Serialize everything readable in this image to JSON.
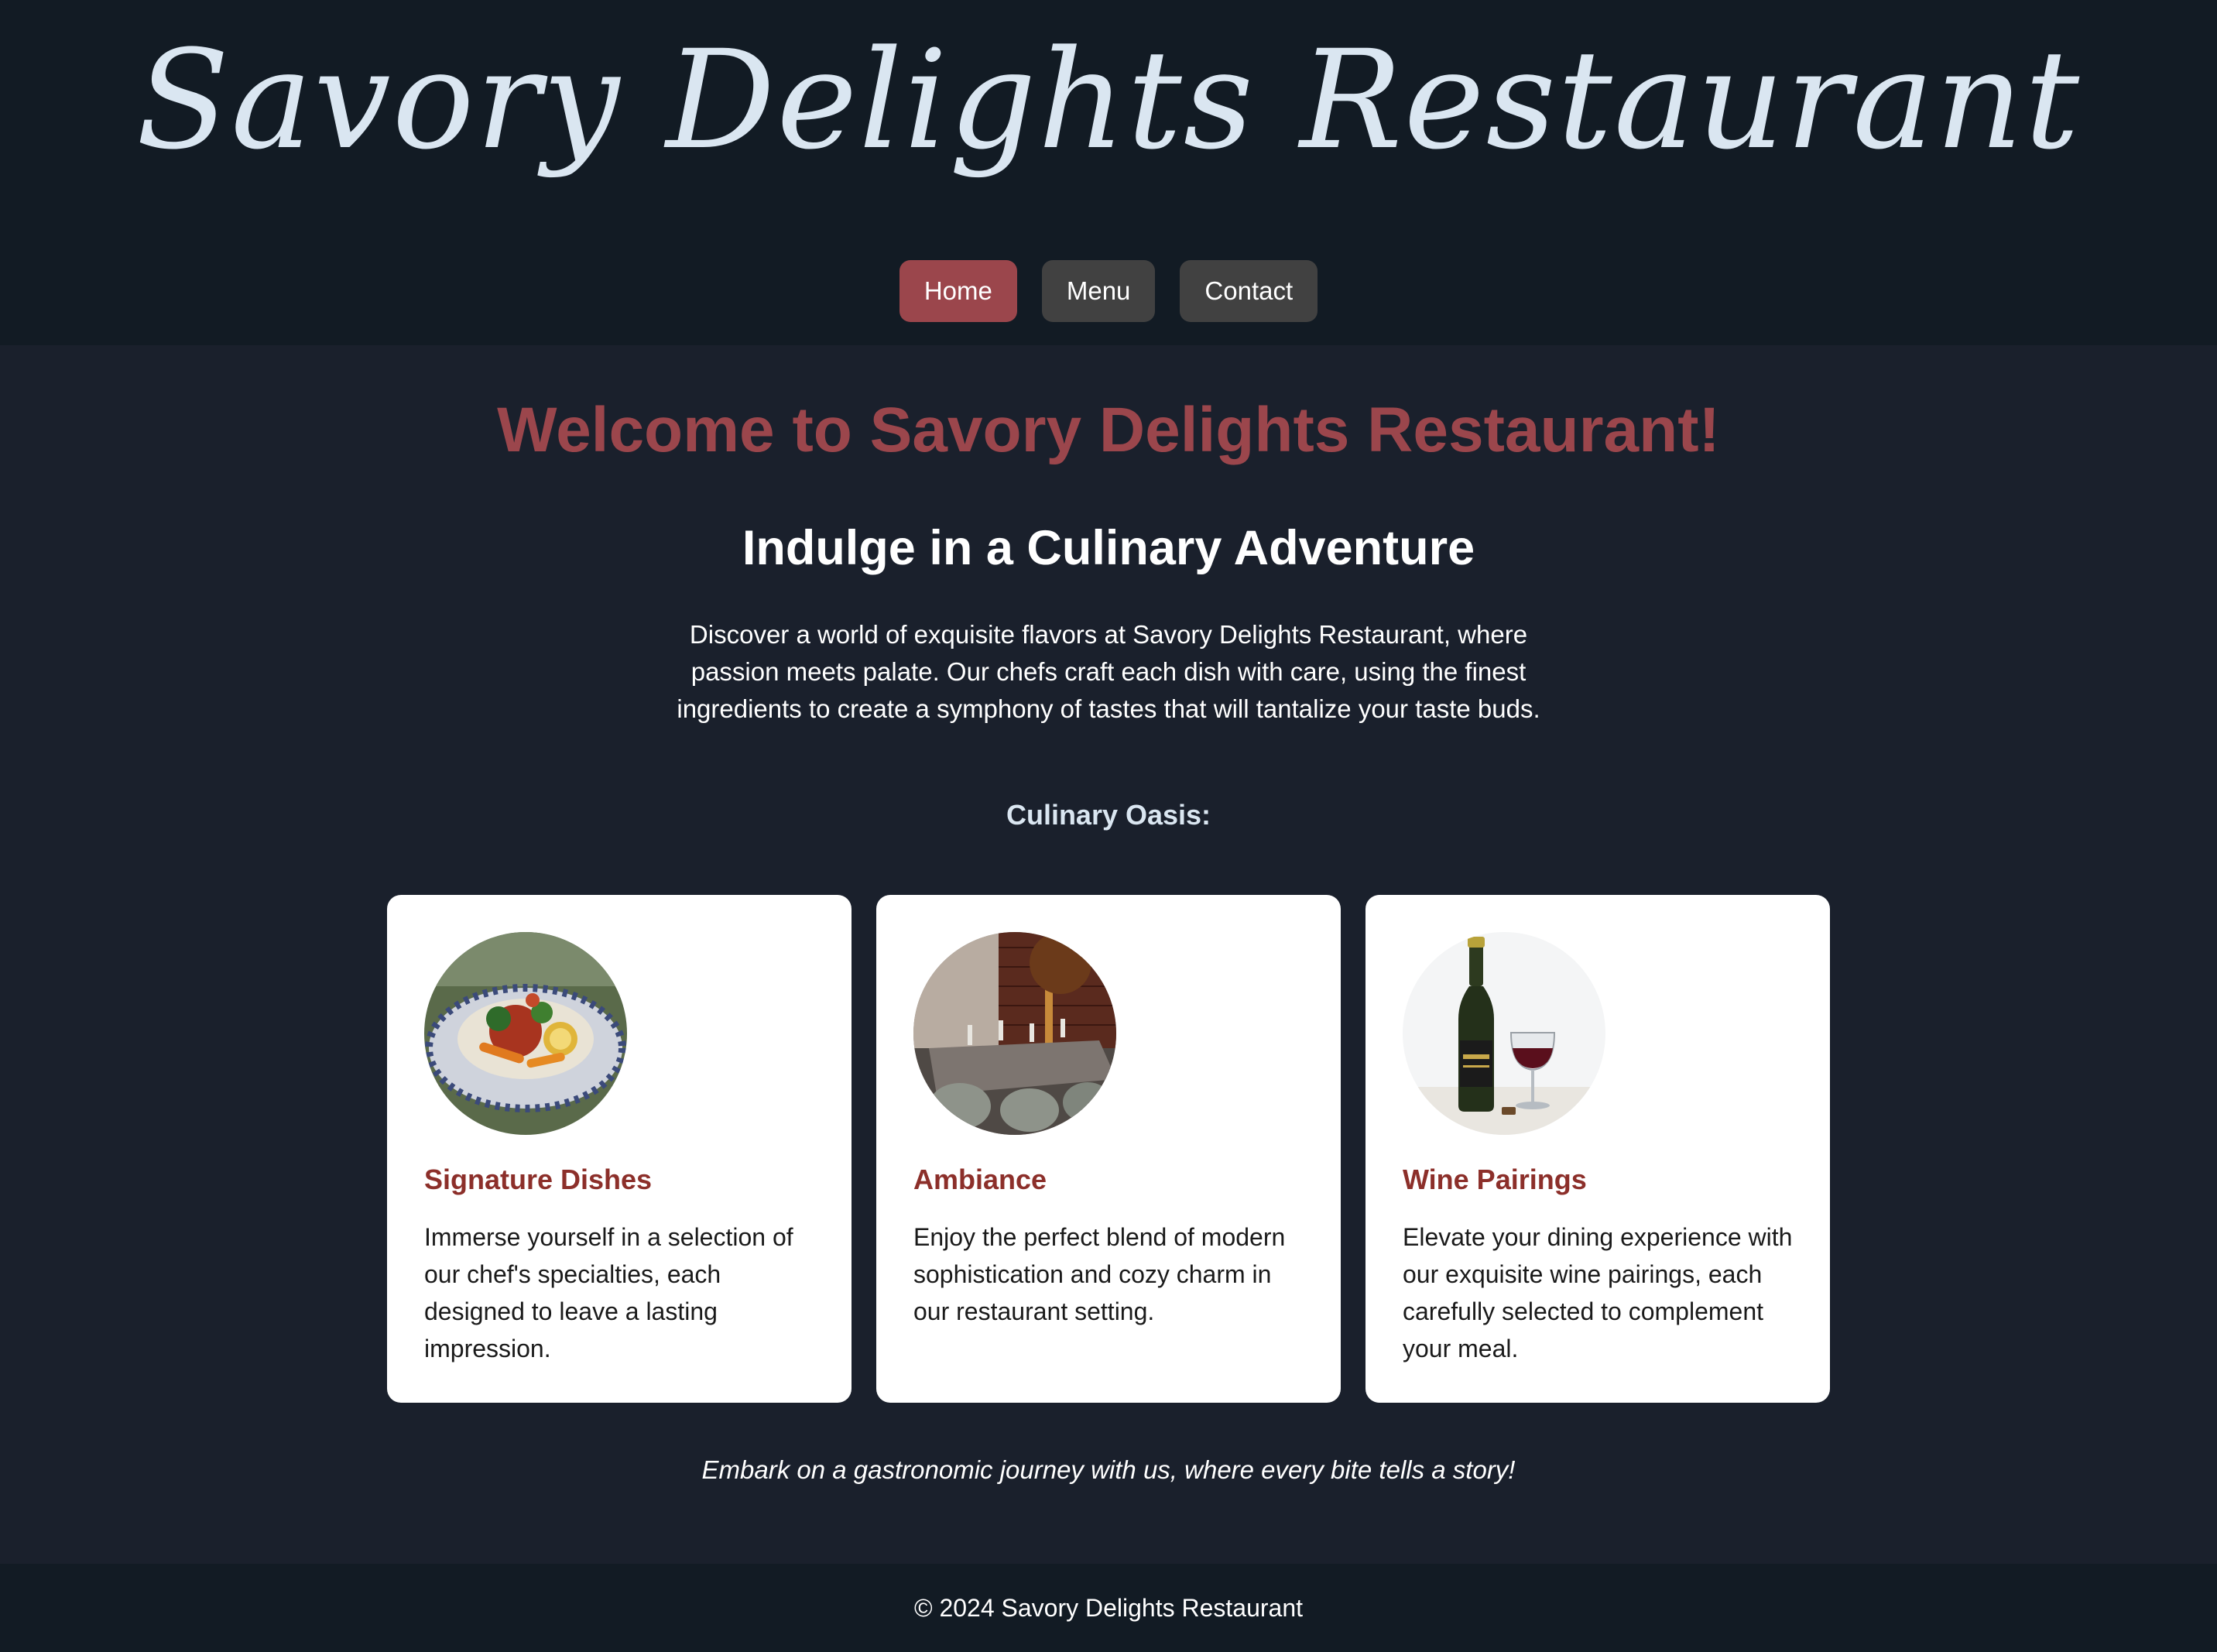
{
  "header": {
    "title": "Savory Delights Restaurant",
    "nav": [
      {
        "label": "Home",
        "active": true
      },
      {
        "label": "Menu",
        "active": false
      },
      {
        "label": "Contact",
        "active": false
      }
    ]
  },
  "main": {
    "welcome": "Welcome to Savory Delights Restaurant!",
    "subheading": "Indulge in a Culinary Adventure",
    "intro": "Discover a world of exquisite flavors at Savory Delights Restaurant, where passion meets palate. Our chefs craft each dish with care, using the finest ingredients to create a symphony of tastes that will tantalize your taste buds.",
    "section_label": "Culinary Oasis:",
    "cards": [
      {
        "title": "Signature Dishes",
        "text": "Immerse yourself in a selection of our chef's specialties, each designed to leave a lasting impression.",
        "image": "plated-dish-photo"
      },
      {
        "title": "Ambiance",
        "text": "Enjoy the perfect blend of modern sophistication and cozy charm in our restaurant setting.",
        "image": "dining-room-photo"
      },
      {
        "title": "Wine Pairings",
        "text": "Elevate your dining experience with our exquisite wine pairings, each carefully selected to complement your meal.",
        "image": "wine-bottle-and-glass-photo"
      }
    ],
    "tagline": "Embark on a gastronomic journey with us, where every bite tells a story!"
  },
  "footer": {
    "copyright": "© 2024 Savory Delights Restaurant"
  },
  "colors": {
    "header_bg": "#121b24",
    "page_bg": "#1a202c",
    "accent": "#9b464c",
    "nav_button": "#414141",
    "card_title": "#8c2f2a",
    "title_text": "#dae6f1"
  }
}
